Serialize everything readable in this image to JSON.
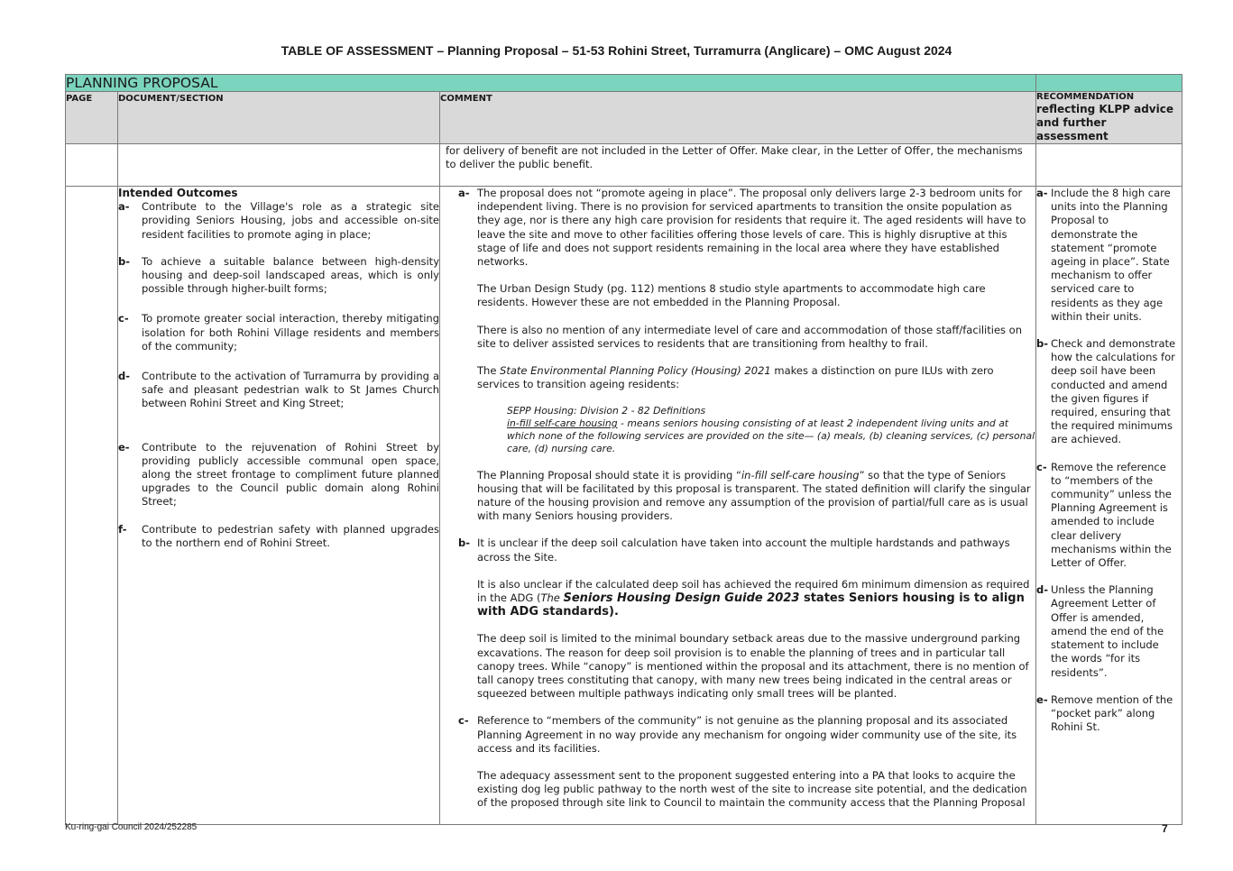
{
  "title": "TABLE OF ASSESSMENT – Planning Proposal – 51-53 Rohini Street, Turramurra (Anglicare) – OMC August 2024",
  "section_title": "PLANNING PROPOSAL",
  "headers": {
    "page": "PAGE",
    "document": "DOCUMENT/SECTION",
    "comment": "COMMENT",
    "rec_small": "RECOMMENDATION",
    "rec_big": "reflecting KLPP advice and further assessment"
  },
  "continued_comment": "for delivery of benefit are not included in the Letter of Offer. Make clear, in the Letter of Offer, the mechanisms to deliver the public benefit.",
  "document": {
    "heading": "Intended Outcomes",
    "items": [
      {
        "label": "a-",
        "text": "Contribute to the Village's role as a strategic site providing Seniors Housing, jobs and accessible on-site resident facilities to promote aging in place;"
      },
      {
        "label": "b-",
        "text": "To achieve a suitable balance between high-density housing and deep-soil landscaped areas, which is only possible through higher-built forms;"
      },
      {
        "label": "c-",
        "text": "To promote greater social interaction, thereby mitigating isolation for both Rohini Village residents and members of the community;"
      },
      {
        "label": "d-",
        "text": "Contribute to the activation of Turramurra by providing a safe and pleasant pedestrian walk to St James Church between Rohini Street and King Street;"
      },
      {
        "label": "e-",
        "text": "Contribute to the rejuvenation of Rohini Street by providing publicly accessible communal open space, along the street frontage to compliment future planned upgrades to the Council public domain along Rohini Street;"
      },
      {
        "label": "f-",
        "text": "Contribute to pedestrian safety with planned upgrades to the northern end of Rohini Street."
      }
    ]
  },
  "comment": {
    "a_label": "a-",
    "a_p1": "The proposal does not “promote ageing in place”. The proposal only delivers large 2-3 bedroom units for independent living. There is no provision for serviced apartments to transition the onsite population as they age, nor is there any high care provision for residents that require it. The aged residents will have to leave the site and move to other facilities offering those levels of care. This is highly disruptive at this stage of life and does not support residents remaining in the local area where they have established networks.",
    "a_p2": "The Urban Design Study (pg. 112) mentions 8 studio style apartments to accommodate high care residents. However these are not embedded in the Planning Proposal.",
    "a_p3": "There is also no mention of any intermediate level of care and accommodation of those staff/facilities on site to deliver assisted services to residents that are transitioning from healthy to frail.",
    "a_p4_pre": "The ",
    "a_p4_ital": "State Environmental Planning Policy (Housing) 2021",
    "a_p4_post": " makes a distinction on pure ILUs with zero services to transition ageing residents:",
    "sepp_heading": "SEPP Housing: Division 2 - 82 Definitions",
    "sepp_term": "in-fill self-care housing",
    "sepp_def": " - means seniors housing consisting of at least 2 independent living units and at which none of the following services are provided on the site— (a) meals, (b) cleaning services, (c) personal care, (d) nursing care.",
    "a_p5_pre": "The Planning Proposal should state it is providing “",
    "a_p5_ital": "in-fill self-care housing",
    "a_p5_post": "” so that the type of Seniors housing that will be facilitated by this proposal is transparent. The stated definition will clarify the singular nature of the housing provision and remove any assumption of the provision of partial/full care as is usual with many Seniors housing providers.",
    "b_label": "b-",
    "b_p1": "It is unclear if the deep soil calculation have taken into account the multiple hardstands and pathways across the Site.",
    "b_p2_pre": "It is also unclear if the calculated deep soil has achieved the required 6m minimum dimension as required in the ADG (",
    "b_p2_ital": "The ",
    "b_p2_bigital": "Seniors Housing Design Guide 2023",
    "b_p2_big": " states Seniors housing is to align with ADG standards).",
    "b_p3": "The deep soil is limited to the minimal boundary setback areas due to the massive underground parking excavations. The reason for deep soil provision is to enable the planning of trees and in particular tall canopy trees. While “canopy” is mentioned within the proposal and its attachment, there is no mention of tall canopy trees constituting that canopy, with many new trees being indicated in the central areas or squeezed between multiple pathways indicating only small trees will be planted.",
    "c_label": "c-",
    "c_p1": "Reference to “members of the community” is not genuine as the planning proposal and its associated Planning Agreement in no way provide any mechanism for ongoing wider community use of the site, its access and its facilities.",
    "c_p2": "The adequacy assessment sent to the proponent suggested entering into a PA that looks to acquire the existing dog leg public pathway to the north west of the site to increase site potential, and the dedication of the proposed through site link to Council to maintain the community access that the Planning Proposal"
  },
  "recommendations": [
    {
      "label": "a-",
      "text": "Include the 8 high care units into the Planning Proposal to demonstrate the statement “promote ageing in place”. State mechanism to offer serviced care to residents as they age within their units."
    },
    {
      "label": "b-",
      "text": "Check and demonstrate how the calculations for deep soil have been conducted and amend the given figures if required, ensuring that the required minimums are achieved."
    },
    {
      "label": "c-",
      "text": "Remove the reference to “members of the community” unless the Planning Agreement is amended to include clear delivery mechanisms within the Letter of Offer."
    },
    {
      "label": "d-",
      "text": "Unless the Planning Agreement Letter of Offer is amended, amend the end of the statement to include the words “for its residents”."
    },
    {
      "label": "e-",
      "text": "Remove mention of the “pocket park” along Rohini St."
    }
  ],
  "footer": {
    "left": "Ku-ring-gai Council 2024/252285",
    "page_number": "7"
  }
}
